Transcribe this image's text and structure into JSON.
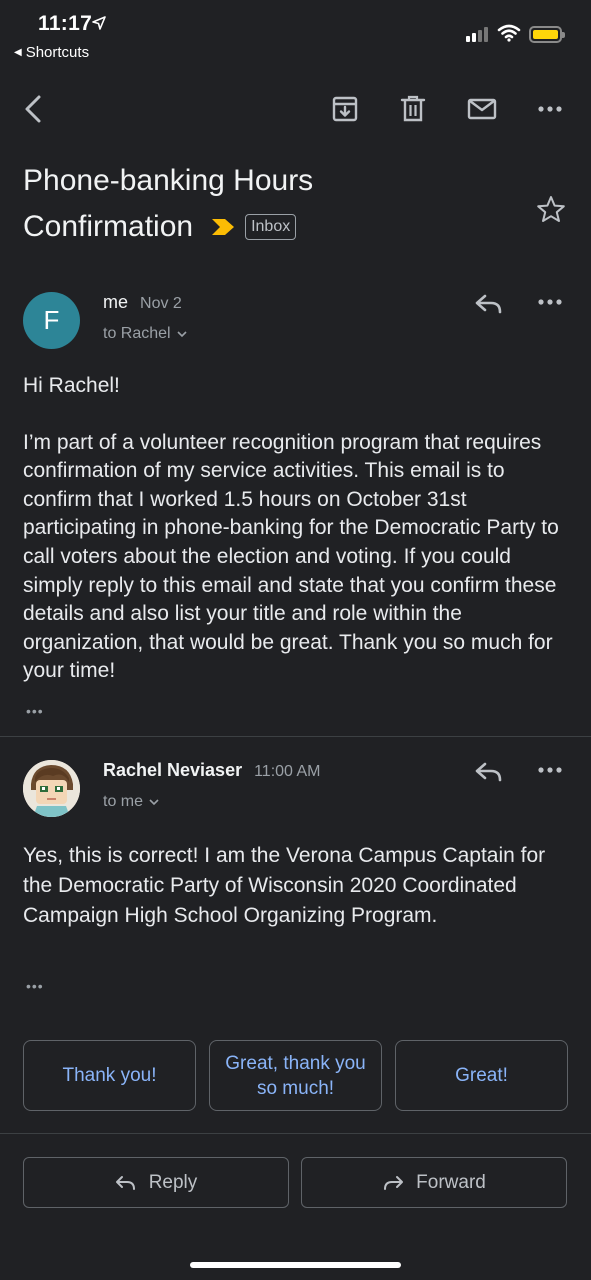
{
  "status_bar": {
    "time": "11:17",
    "back_app_label": "Shortcuts",
    "battery_color": "#ffd60a"
  },
  "toolbar": {
    "icons": [
      "back-arrow-icon",
      "archive-icon",
      "trash-icon",
      "mail-icon",
      "more-icon"
    ]
  },
  "email": {
    "subject_line1": "Phone-banking Hours",
    "subject_line2": "Confirmation",
    "label": "Inbox",
    "importance_color": "#fbbc04"
  },
  "messages": [
    {
      "avatar_letter": "F",
      "avatar_color": "#2d8597",
      "sender": "me",
      "date": "Nov 2",
      "recipient": "to Rachel",
      "greeting": "Hi Rachel!",
      "body": "I’m part of a volunteer recognition program that requires confirmation of my service activities. This email is to confirm that I worked 1.5 hours on October 31st participating in phone-banking for the Democratic Party to call voters about the election and voting. If you could simply reply to this email and state that you confirm these details and also list your title and role within the organization, that would be great. Thank you so much for your time!",
      "ellipsis": "•••"
    },
    {
      "sender": "Rachel Neviaser",
      "date": "11:00 AM",
      "recipient": "to me",
      "body": "Yes, this is correct! I am the Verona Campus Captain for the Democratic Party of Wisconsin 2020 Coordinated Campaign High School Organizing Program.",
      "ellipsis": "•••"
    }
  ],
  "smart_replies": [
    "Thank you!",
    "Great, thank you so much!",
    "Great!"
  ],
  "actions": {
    "reply_label": "Reply",
    "forward_label": "Forward"
  },
  "colors": {
    "background": "#202124",
    "link_blue": "#8ab4f8"
  }
}
